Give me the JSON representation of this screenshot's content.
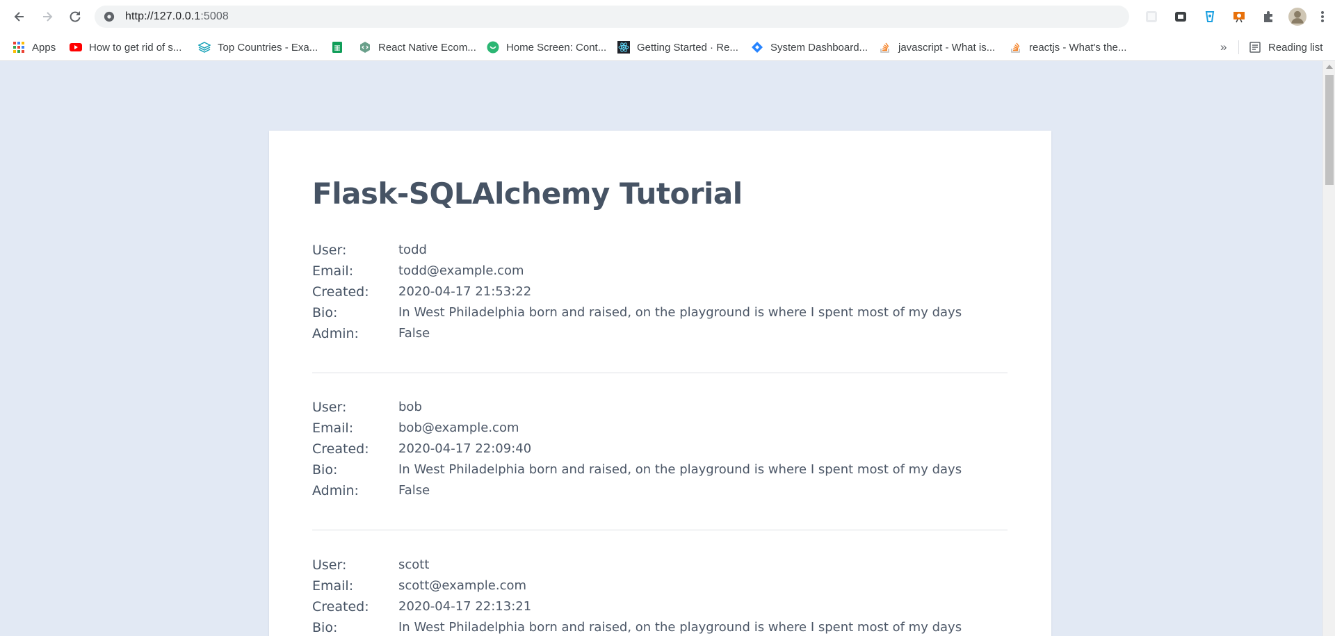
{
  "browser": {
    "url_host": "http://127.0.0.1",
    "url_port": ":5008",
    "reading_list_label": "Reading list",
    "overflow_label": "»"
  },
  "bookmarks": [
    {
      "label": "Apps",
      "icon": "apps-grid-icon"
    },
    {
      "label": "How to get rid of s...",
      "icon": "youtube-icon"
    },
    {
      "label": "Top Countries - Exa...",
      "icon": "layers-icon"
    },
    {
      "label": "",
      "icon": "sheets-icon"
    },
    {
      "label": "React Native Ecom...",
      "icon": "code-hex-icon"
    },
    {
      "label": "Home Screen: Cont...",
      "icon": "green-circle-icon"
    },
    {
      "label": "Getting Started · Re...",
      "icon": "react-icon"
    },
    {
      "label": "System Dashboard...",
      "icon": "jira-diamond-icon"
    },
    {
      "label": "javascript - What is...",
      "icon": "stackoverflow-icon"
    },
    {
      "label": "reactjs - What's the...",
      "icon": "stackoverflow-icon"
    }
  ],
  "page": {
    "title": "Flask-SQLAlchemy Tutorial",
    "labels": {
      "user": "User:",
      "email": "Email:",
      "created": "Created:",
      "bio": "Bio:",
      "admin": "Admin:"
    },
    "users": [
      {
        "user": "todd",
        "email": "todd@example.com",
        "created": "2020-04-17 21:53:22",
        "bio": "In West Philadelphia born and raised, on the playground is where I spent most of my days",
        "admin": "False"
      },
      {
        "user": "bob",
        "email": "bob@example.com",
        "created": "2020-04-17 22:09:40",
        "bio": "In West Philadelphia born and raised, on the playground is where I spent most of my days",
        "admin": "False"
      },
      {
        "user": "scott",
        "email": "scott@example.com",
        "created": "2020-04-17 22:13:21",
        "bio": "In West Philadelphia born and raised, on the playground is where I spent most of my days"
      }
    ]
  },
  "colors": {
    "page_bg": "#e2e9f4",
    "card_bg": "#ffffff",
    "heading": "#465364",
    "text": "#4c5767"
  }
}
